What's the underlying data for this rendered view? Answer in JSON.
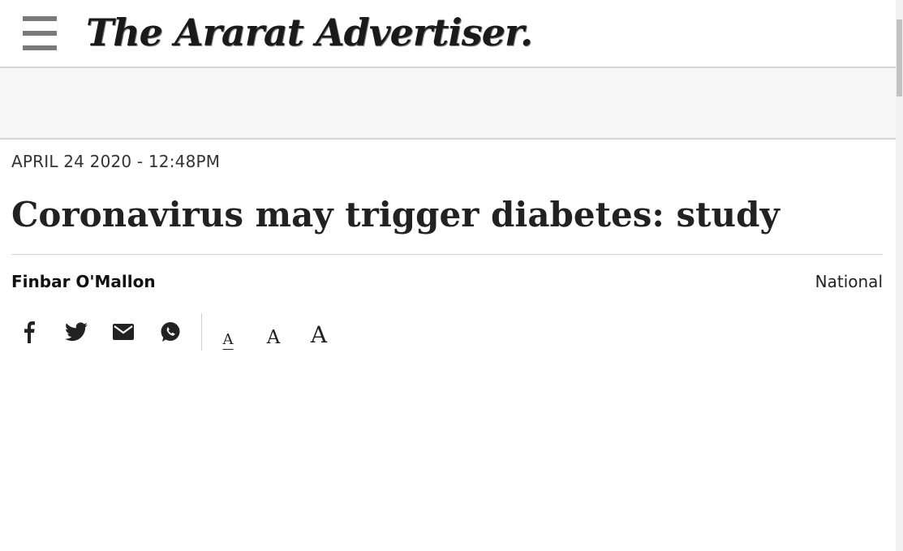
{
  "header": {
    "masthead": "The Ararat Advertiser."
  },
  "article": {
    "date": "APRIL 24 2020 - 12:48PM",
    "title": "Coronavirus may trigger diabetes: study",
    "author": "Finbar O'Mallon",
    "section": "National"
  },
  "share": {
    "icons": [
      "facebook-icon",
      "twitter-icon",
      "email-icon",
      "whatsapp-icon"
    ]
  },
  "font_size": {
    "small_label": "A",
    "medium_label": "A",
    "large_label": "A"
  }
}
